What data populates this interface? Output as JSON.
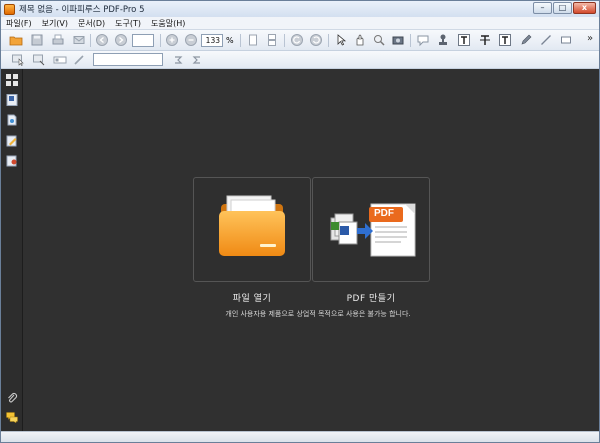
{
  "window": {
    "title": "제목 없음 - 이파피루스 PDF-Pro 5",
    "controls": {
      "minimize": "–",
      "maximize": "□",
      "close": "x"
    }
  },
  "menu": [
    {
      "label": "파일(F)"
    },
    {
      "label": "보기(V)"
    },
    {
      "label": "문서(D)"
    },
    {
      "label": "도구(T)"
    },
    {
      "label": "도움말(H)"
    }
  ],
  "toolbar": {
    "page_field": "",
    "zoom_value": "133",
    "zoom_unit": "%",
    "overflow": "»",
    "search_field": ""
  },
  "main": {
    "open_label": "파일 열기",
    "create_label": "PDF 만들기",
    "pdf_badge": "PDF",
    "notice": "개인 사용자용 제품으로 상업적 목적으로 사용은 불가능 합니다."
  },
  "colors": {
    "workspace": "#303030",
    "folder": "#f5a02a",
    "pdf_badge": "#ea6a1d"
  }
}
